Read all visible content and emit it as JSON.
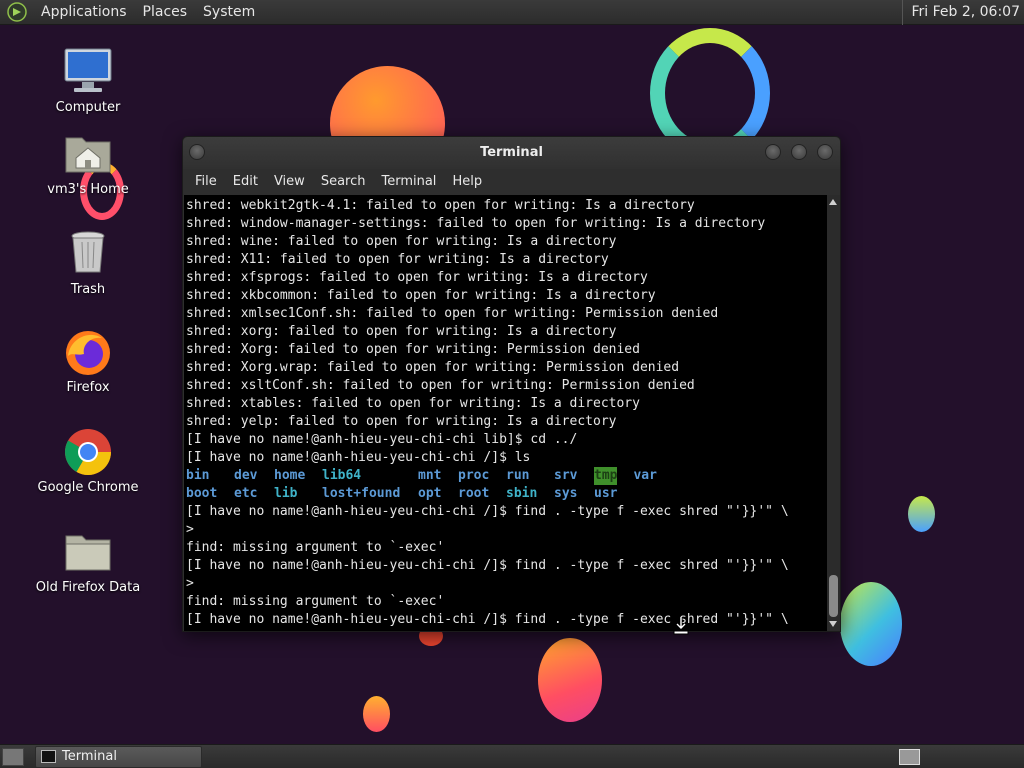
{
  "top_panel": {
    "menus": [
      "Applications",
      "Places",
      "System"
    ],
    "clock": "Fri Feb 2, 06:07"
  },
  "desktop": {
    "icons": [
      {
        "label": "Computer",
        "icon": "computer-icon"
      },
      {
        "label": "vm3's Home",
        "icon": "home-folder-icon"
      },
      {
        "label": "Trash",
        "icon": "trash-icon"
      },
      {
        "label": "Firefox",
        "icon": "firefox-icon"
      },
      {
        "label": "Google Chrome",
        "icon": "chrome-icon"
      },
      {
        "label": "Old Firefox Data",
        "icon": "folder-icon"
      }
    ]
  },
  "terminal": {
    "title": "Terminal",
    "menu": [
      "File",
      "Edit",
      "View",
      "Search",
      "Terminal",
      "Help"
    ],
    "lines_before": [
      "shred: webkit2gtk-4.1: failed to open for writing: Is a directory",
      "shred: window-manager-settings: failed to open for writing: Is a directory",
      "shred: wine: failed to open for writing: Is a directory",
      "shred: X11: failed to open for writing: Is a directory",
      "shred: xfsprogs: failed to open for writing: Is a directory",
      "shred: xkbcommon: failed to open for writing: Is a directory",
      "shred: xmlsec1Conf.sh: failed to open for writing: Permission denied",
      "shred: xorg: failed to open for writing: Is a directory",
      "shred: Xorg: failed to open for writing: Permission denied",
      "shred: Xorg.wrap: failed to open for writing: Permission denied",
      "shred: xsltConf.sh: failed to open for writing: Permission denied",
      "shred: xtables: failed to open for writing: Is a directory",
      "shred: yelp: failed to open for writing: Is a directory",
      "[I have no name!@anh-hieu-yeu-chi-chi lib]$ cd ../",
      "[I have no name!@anh-hieu-yeu-chi-chi /]$ ls"
    ],
    "ls_rows": [
      [
        "bin",
        "dev",
        "home",
        "lib64",
        "mnt",
        "proc",
        "run",
        "srv",
        "tmp",
        "var"
      ],
      [
        "boot",
        "etc",
        "lib",
        "lost+found",
        "opt",
        "root",
        "sbin",
        "sys",
        "usr"
      ]
    ],
    "lines_after": [
      "[I have no name!@anh-hieu-yeu-chi-chi /]$ find . -type f -exec shred \"'}}'\" \\",
      ">",
      "find: missing argument to `-exec'",
      "[I have no name!@anh-hieu-yeu-chi-chi /]$ find . -type f -exec shred \"'}}'\" \\",
      ">",
      "find: missing argument to `-exec'",
      "[I have no name!@anh-hieu-yeu-chi-chi /]$ find . -type f -exec shred \"'}}'\" \\"
    ]
  },
  "bottom_panel": {
    "task_label": "Terminal"
  }
}
